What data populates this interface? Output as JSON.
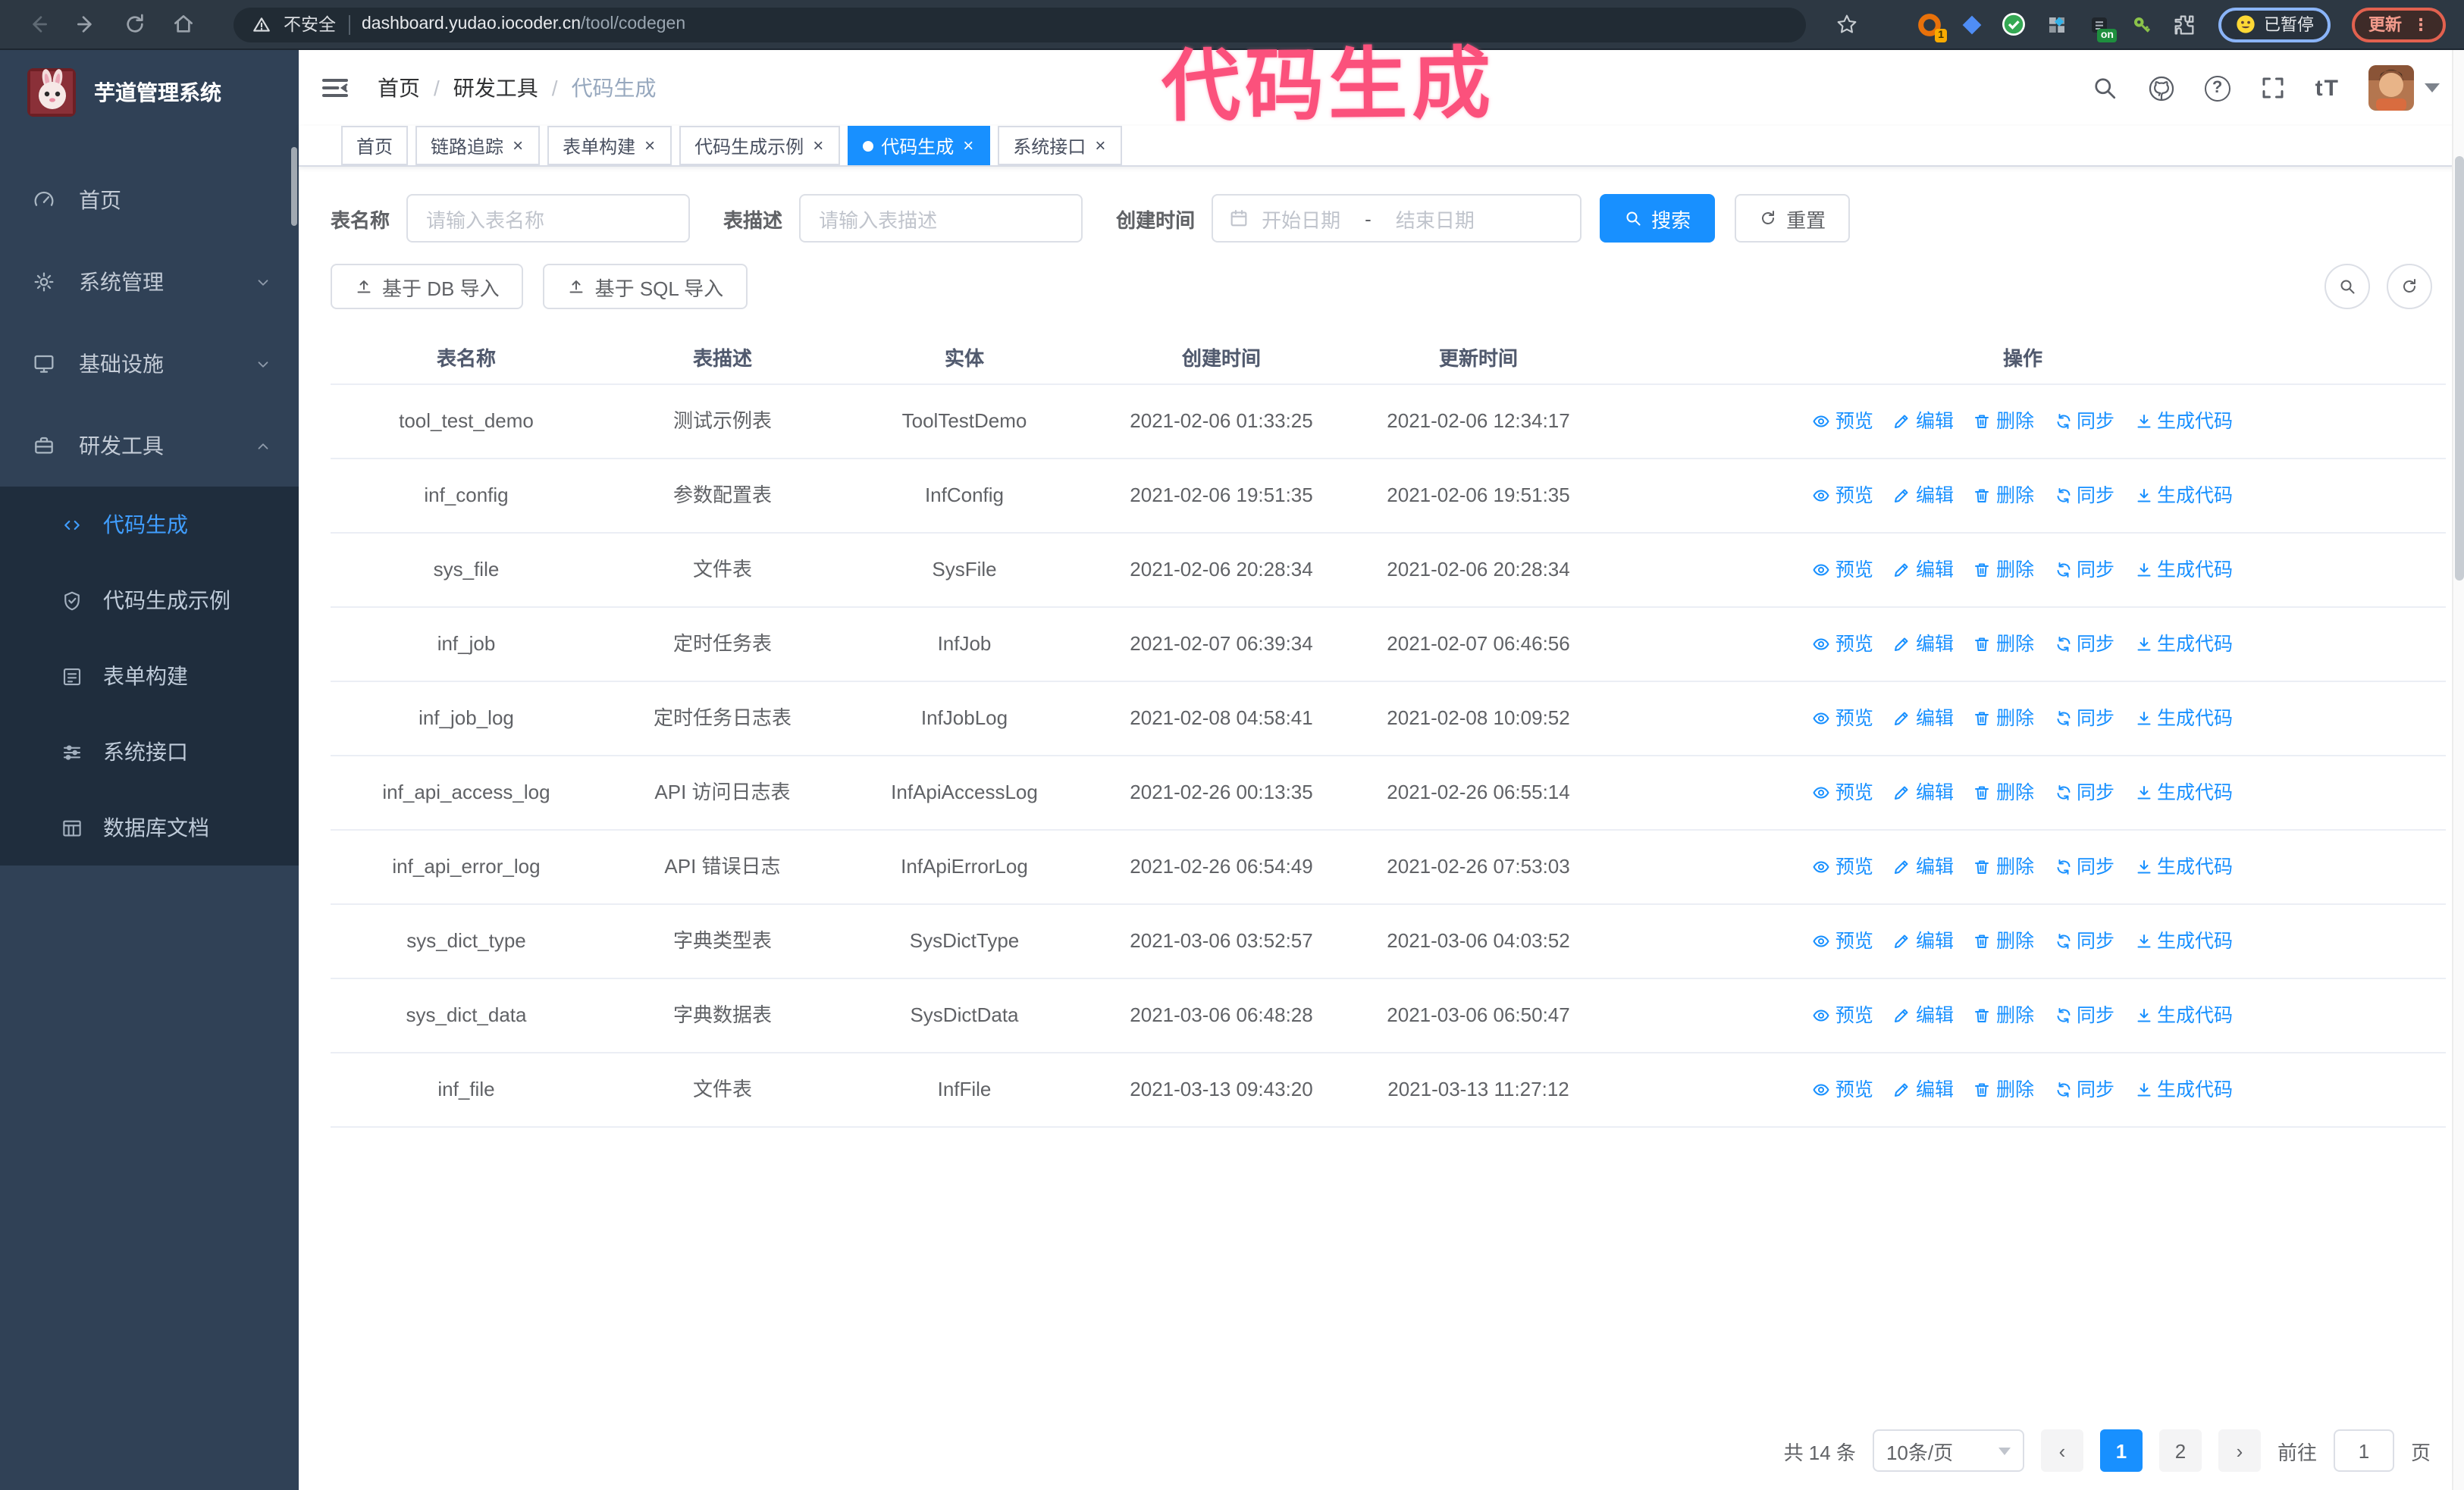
{
  "colors": {
    "accent": "#1890ff",
    "sidebar_active": "#409eff",
    "annotation_pink": "#fb517c",
    "sidebar_bg": "#304156",
    "submenu_bg": "#1f2d3d"
  },
  "browser": {
    "security_label": "不安全",
    "url_host": "dashboard.yudao.iocoder.cn",
    "url_path": "/tool/codegen",
    "extension_badge_count": "1",
    "extension_badge_on": "on",
    "paused_badge_label": "已暂停",
    "update_button_label": "更新"
  },
  "annotation": {
    "text": "代码生成"
  },
  "sidebar": {
    "title": "芋道管理系统",
    "items": [
      {
        "label": "首页",
        "icon": "dashboard",
        "chevron": null
      },
      {
        "label": "系统管理",
        "icon": "gear",
        "chevron": "down"
      },
      {
        "label": "基础设施",
        "icon": "monitor",
        "chevron": "down"
      },
      {
        "label": "研发工具",
        "icon": "toolbox",
        "chevron": "up"
      }
    ],
    "submenu": [
      {
        "label": "代码生成",
        "icon": "code",
        "active": true
      },
      {
        "label": "代码生成示例",
        "icon": "shield",
        "active": false
      },
      {
        "label": "表单构建",
        "icon": "form",
        "active": false
      },
      {
        "label": "系统接口",
        "icon": "sliders",
        "active": false
      },
      {
        "label": "数据库文档",
        "icon": "dbtable",
        "active": false
      }
    ]
  },
  "header": {
    "breadcrumb": [
      "首页",
      "研发工具",
      "代码生成"
    ],
    "font_size_icon_text": "tT"
  },
  "tabs": [
    {
      "label": "首页",
      "closable": false,
      "active": false
    },
    {
      "label": "链路追踪",
      "closable": true,
      "active": false
    },
    {
      "label": "表单构建",
      "closable": true,
      "active": false
    },
    {
      "label": "代码生成示例",
      "closable": true,
      "active": false
    },
    {
      "label": "代码生成",
      "closable": true,
      "active": true
    },
    {
      "label": "系统接口",
      "closable": true,
      "active": false
    }
  ],
  "filters": {
    "table_name_label": "表名称",
    "table_name_placeholder": "请输入表名称",
    "table_desc_label": "表描述",
    "table_desc_placeholder": "请输入表描述",
    "create_time_label": "创建时间",
    "date_start_placeholder": "开始日期",
    "date_separator": "-",
    "date_end_placeholder": "结束日期",
    "search_label": "搜索",
    "reset_label": "重置"
  },
  "toolbar": {
    "import_db_label": "基于 DB 导入",
    "import_sql_label": "基于 SQL 导入"
  },
  "table": {
    "columns": [
      "表名称",
      "表描述",
      "实体",
      "创建时间",
      "更新时间",
      "操作"
    ],
    "actions": [
      "预览",
      "编辑",
      "删除",
      "同步",
      "生成代码"
    ],
    "action_icons": [
      "eye",
      "edit",
      "delete",
      "sync",
      "download"
    ],
    "rows": [
      {
        "name": "tool_test_demo",
        "desc": "测试示例表",
        "entity": "ToolTestDemo",
        "created": "2021-02-06 01:33:25",
        "updated": "2021-02-06 12:34:17"
      },
      {
        "name": "inf_config",
        "desc": "参数配置表",
        "entity": "InfConfig",
        "created": "2021-02-06 19:51:35",
        "updated": "2021-02-06 19:51:35"
      },
      {
        "name": "sys_file",
        "desc": "文件表",
        "entity": "SysFile",
        "created": "2021-02-06 20:28:34",
        "updated": "2021-02-06 20:28:34"
      },
      {
        "name": "inf_job",
        "desc": "定时任务表",
        "entity": "InfJob",
        "created": "2021-02-07 06:39:34",
        "updated": "2021-02-07 06:46:56"
      },
      {
        "name": "inf_job_log",
        "desc": "定时任务日志表",
        "entity": "InfJobLog",
        "created": "2021-02-08 04:58:41",
        "updated": "2021-02-08 10:09:52"
      },
      {
        "name": "inf_api_access_log",
        "desc": "API 访问日志表",
        "entity": "InfApiAccessLog",
        "created": "2021-02-26 00:13:35",
        "updated": "2021-02-26 06:55:14"
      },
      {
        "name": "inf_api_error_log",
        "desc": "API 错误日志",
        "entity": "InfApiErrorLog",
        "created": "2021-02-26 06:54:49",
        "updated": "2021-02-26 07:53:03"
      },
      {
        "name": "sys_dict_type",
        "desc": "字典类型表",
        "entity": "SysDictType",
        "created": "2021-03-06 03:52:57",
        "updated": "2021-03-06 04:03:52"
      },
      {
        "name": "sys_dict_data",
        "desc": "字典数据表",
        "entity": "SysDictData",
        "created": "2021-03-06 06:48:28",
        "updated": "2021-03-06 06:50:47"
      },
      {
        "name": "inf_file",
        "desc": "文件表",
        "entity": "InfFile",
        "created": "2021-03-13 09:43:20",
        "updated": "2021-03-13 11:27:12"
      }
    ]
  },
  "pagination": {
    "total_label": "共 14 条",
    "page_size_label": "10条/页",
    "pages": [
      "1",
      "2"
    ],
    "active_page": "1",
    "goto_label": "前往",
    "goto_value": "1",
    "page_unit_label": "页"
  }
}
